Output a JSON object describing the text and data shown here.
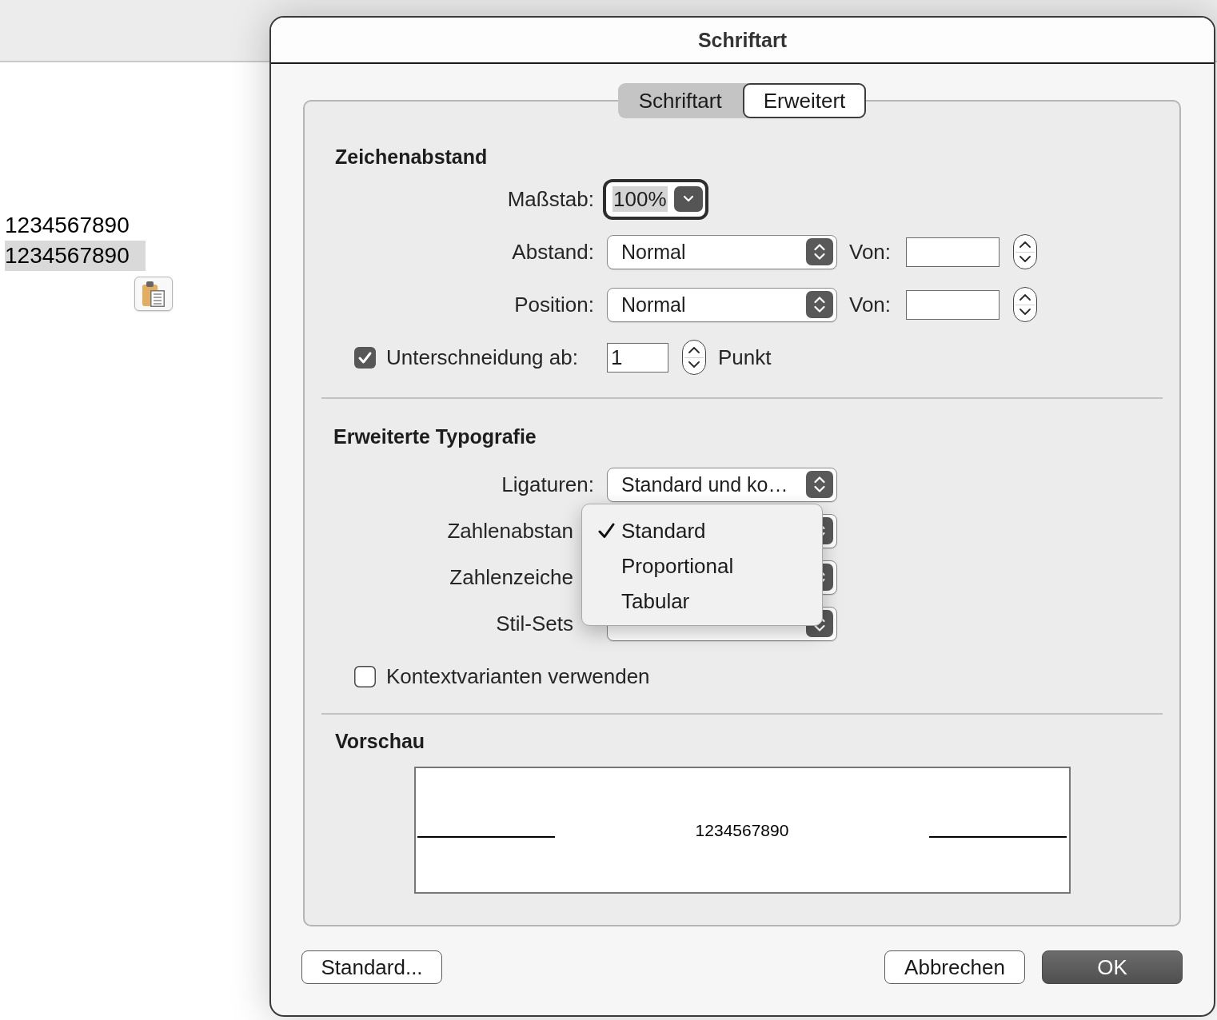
{
  "document": {
    "lines": [
      {
        "text": "1234567890",
        "selected": false
      },
      {
        "text": "1234567890",
        "selected": true
      }
    ]
  },
  "dialog": {
    "title": "Schriftart",
    "tabs": [
      {
        "label": "Schriftart",
        "selected": false
      },
      {
        "label": "Erweitert",
        "selected": true
      }
    ],
    "sections": [
      {
        "heading": "Zeichenabstand",
        "rows": [
          {
            "kind": "combo",
            "label": "Maßstab:",
            "value": "100%",
            "focused": true,
            "value_selected": true
          },
          {
            "kind": "popup",
            "label": "Abstand:",
            "value": "Normal",
            "by": {
              "label": "Von:"
            }
          },
          {
            "kind": "popup",
            "label": "Position:",
            "value": "Normal",
            "by": {
              "label": "Von:"
            }
          },
          {
            "kind": "checkbox",
            "label": "Unterschneidung ab:",
            "checked": true,
            "value": "1",
            "unit": "Punkt"
          }
        ]
      },
      {
        "heading": "Erweiterte Typografie",
        "rows": [
          {
            "kind": "popup",
            "label": "Ligaturen:",
            "value": "Standard und ko…"
          },
          {
            "kind": "popup",
            "label": "Zahlenabstan",
            "menu": [
              {
                "label": "Standard",
                "selected": true
              },
              {
                "label": "Proportional",
                "selected": false
              },
              {
                "label": "Tabular",
                "selected": false
              }
            ]
          },
          {
            "kind": "popup",
            "label": "Zahlenzeiche"
          },
          {
            "kind": "popup",
            "label": "Stil-Sets"
          },
          {
            "kind": "checkbox",
            "label": "Kontextvarianten verwenden",
            "checked": false
          }
        ]
      },
      {
        "heading": "Vorschau",
        "preview": {
          "text": "1234567890"
        }
      }
    ],
    "buttons": [
      {
        "label": "Standard...",
        "kind": "secondary"
      },
      {
        "label": "Abbrechen",
        "kind": "secondary"
      },
      {
        "label": "OK",
        "kind": "default"
      }
    ]
  }
}
